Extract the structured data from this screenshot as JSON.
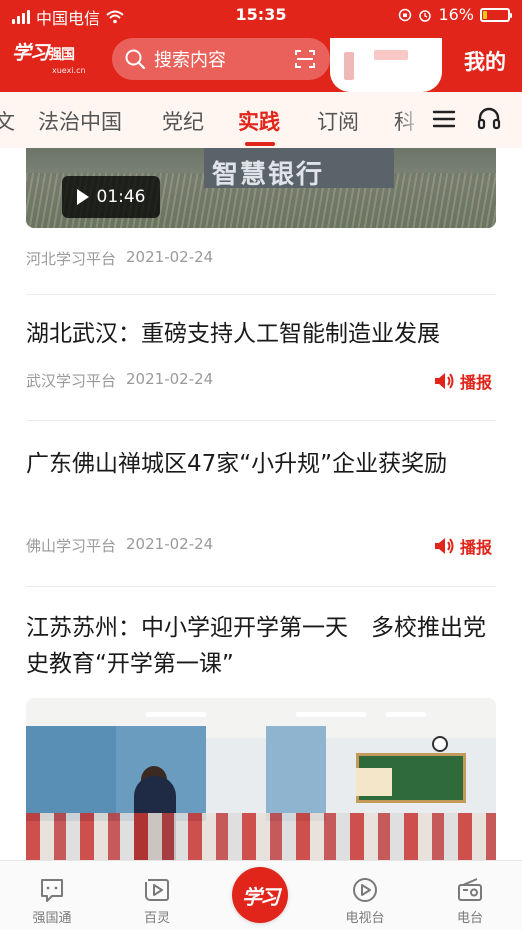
{
  "status_bar": {
    "carrier": "中国电信",
    "time": "15:35",
    "battery": "16%",
    "battery_level": 0.16
  },
  "app_bar": {
    "logo_text": "学习",
    "logo_suffix": "强国",
    "logo_sub": "xuexi.cn",
    "search_placeholder": "搜索内容",
    "mine_label": "我的"
  },
  "tabs": [
    {
      "label": "文"
    },
    {
      "label": "法治中国"
    },
    {
      "label": "党纪"
    },
    {
      "label": "实践",
      "active": true
    },
    {
      "label": "订阅"
    },
    {
      "label": "科"
    }
  ],
  "feed": {
    "video": {
      "sign_text": "智慧银行",
      "duration": "01:46",
      "source": "河北学习平台",
      "date": "2021-02-24"
    },
    "articles": [
      {
        "title": "湖北武汉：重磅支持人工智能制造业发展",
        "source": "武汉学习平台",
        "date": "2021-02-24",
        "action": "播报"
      },
      {
        "title": "广东佛山禅城区47家“小升规”企业获奖励",
        "source": "佛山学习平台",
        "date": "2021-02-24",
        "action": "播报"
      },
      {
        "title": "江苏苏州：中小学迎开学第一天　多校推出党史教育“开学第一课”"
      }
    ]
  },
  "bottom_nav": [
    {
      "label": "强国通",
      "icon": "chat-icon"
    },
    {
      "label": "百灵",
      "icon": "play-square-icon"
    },
    {
      "label": "学习",
      "icon": "xuexi-logo"
    },
    {
      "label": "电视台",
      "icon": "play-circle-icon"
    },
    {
      "label": "电台",
      "icon": "radio-icon"
    }
  ],
  "colors": {
    "brand": "#e1251b",
    "tab_bg": "#fff6f2"
  }
}
